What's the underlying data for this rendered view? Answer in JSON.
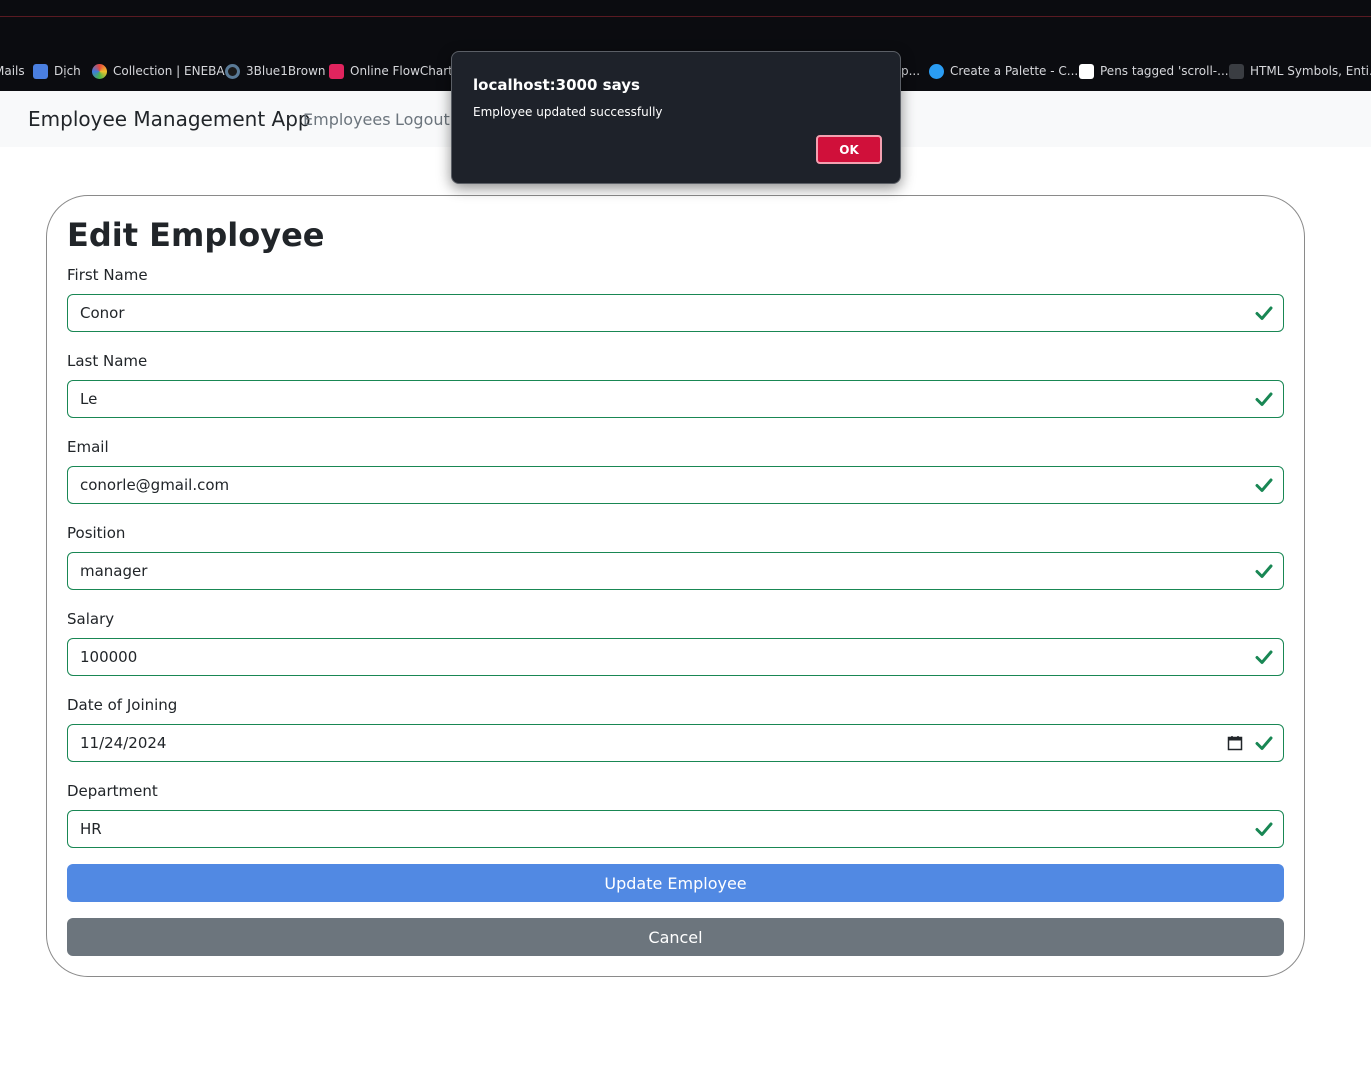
{
  "bookmarks": [
    {
      "label": "Mails",
      "icon": "mail-icon"
    },
    {
      "label": "Dịch",
      "icon": "translate-icon"
    },
    {
      "label": "Collection | ENEBA",
      "icon": "eneba-icon"
    },
    {
      "label": "3Blue1Brown",
      "icon": "3b1b-icon"
    },
    {
      "label": "Online FlowChart &",
      "icon": "flowchart-icon"
    },
    {
      "label": "Create a Palette - C...",
      "icon": "palette-icon"
    },
    {
      "label": "Pens tagged 'scroll-...",
      "icon": "codepen-icon"
    },
    {
      "label": "HTML Symbols, Enti...",
      "icon": "html-symbols-icon"
    }
  ],
  "bookmark_partial": "p...",
  "navbar": {
    "brand": "Employee Management App",
    "links": [
      "Employees",
      "Logout"
    ]
  },
  "form": {
    "title": "Edit Employee",
    "fields": [
      {
        "label": "First Name",
        "value": "Conor"
      },
      {
        "label": "Last Name",
        "value": "Le"
      },
      {
        "label": "Email",
        "value": "conorle@gmail.com"
      },
      {
        "label": "Position",
        "value": "manager"
      },
      {
        "label": "Salary",
        "value": "100000"
      },
      {
        "label": "Date of Joining",
        "value": "11/24/2024"
      },
      {
        "label": "Department",
        "value": "HR"
      }
    ],
    "submit_label": "Update Employee",
    "cancel_label": "Cancel"
  },
  "dialog": {
    "title": "localhost:3000 says",
    "message": "Employee updated successfully",
    "ok_label": "OK"
  },
  "colors": {
    "valid": "#198754",
    "primary": "#5189e3",
    "secondary": "#6c757d",
    "ok": "#d0103a"
  }
}
